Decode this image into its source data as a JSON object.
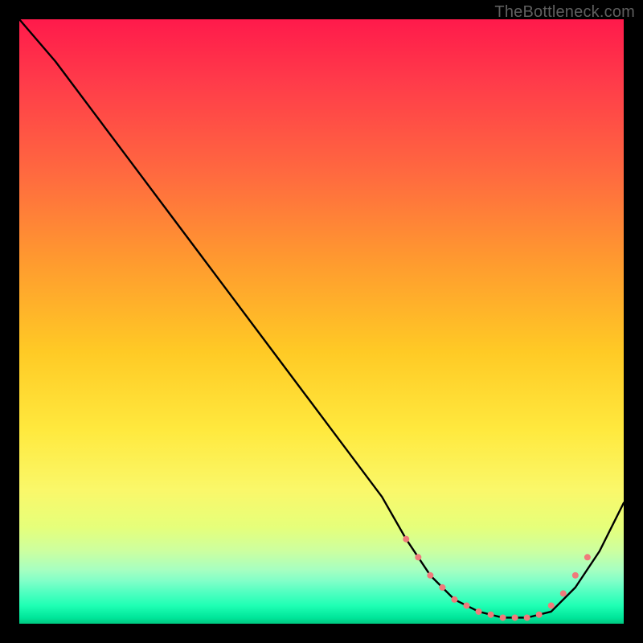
{
  "attribution": "TheBottleneck.com",
  "chart_data": {
    "type": "line",
    "title": "",
    "xlabel": "",
    "ylabel": "",
    "xlim": [
      0,
      100
    ],
    "ylim": [
      0,
      100
    ],
    "grid": false,
    "legend": false,
    "background": "rainbow-vertical-gradient",
    "series": [
      {
        "name": "curve",
        "x": [
          0,
          6,
          12,
          18,
          24,
          30,
          36,
          42,
          48,
          54,
          60,
          64,
          68,
          72,
          76,
          80,
          84,
          88,
          92,
          96,
          100
        ],
        "y": [
          100,
          93,
          85,
          77,
          69,
          61,
          53,
          45,
          37,
          29,
          21,
          14,
          8,
          4,
          2,
          1,
          1,
          2,
          6,
          12,
          20
        ],
        "color": "#000000"
      }
    ],
    "markers": {
      "comment": "dotted salmon markers along the valley of the curve",
      "color": "#ef7b7b",
      "radius_approx": 4,
      "points_xy": [
        [
          64,
          14
        ],
        [
          66,
          11
        ],
        [
          68,
          8
        ],
        [
          70,
          6
        ],
        [
          72,
          4
        ],
        [
          74,
          3
        ],
        [
          76,
          2
        ],
        [
          78,
          1.5
        ],
        [
          80,
          1
        ],
        [
          82,
          1
        ],
        [
          84,
          1
        ],
        [
          86,
          1.5
        ],
        [
          88,
          3
        ],
        [
          90,
          5
        ],
        [
          92,
          8
        ],
        [
          94,
          11
        ]
      ]
    }
  }
}
